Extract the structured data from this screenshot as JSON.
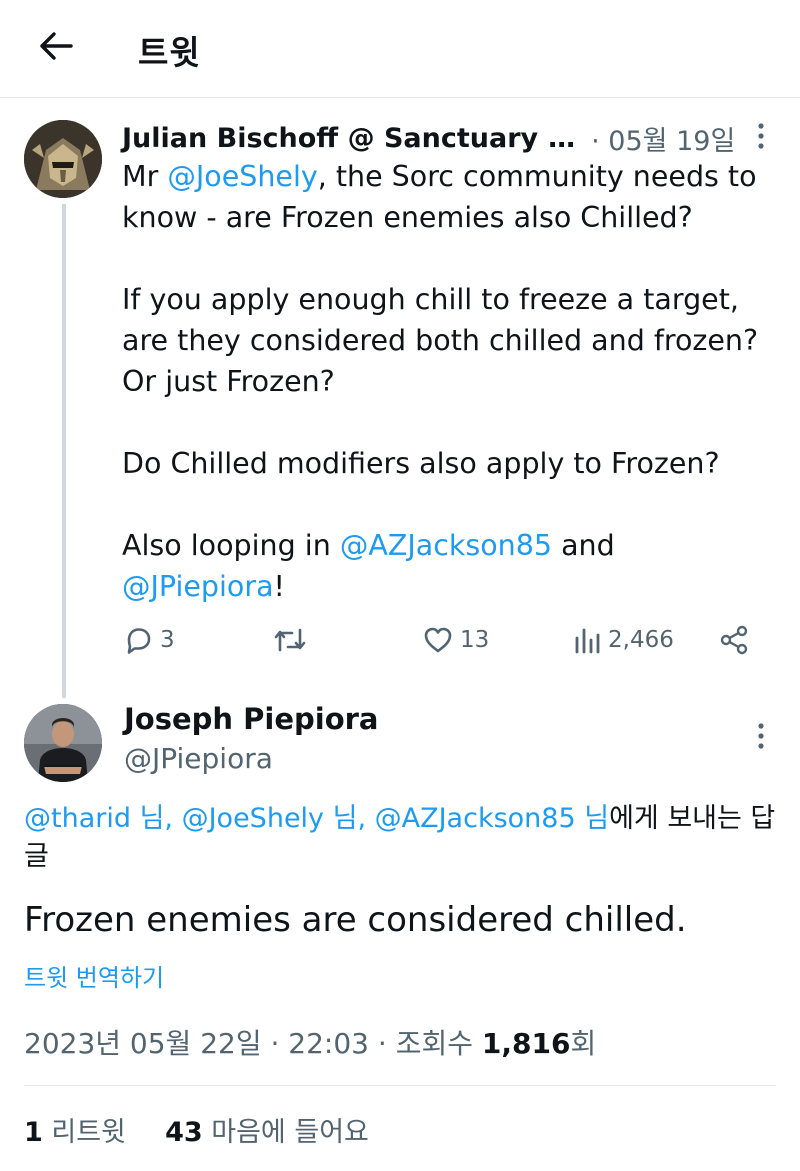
{
  "header": {
    "title": "트윗"
  },
  "thread_tweet": {
    "name": "Julian Bischoff @ Sanctuary",
    "ellipsis": "…",
    "time": "· 05월 19일",
    "text_parts": {
      "p1_pre": "Mr ",
      "p1_mention": "@JoeShely",
      "p1_post": ", the Sorc community needs to know - are Frozen enemies also Chilled?",
      "p2": "If you apply enough chill to freeze a target, are they considered both chilled and frozen? Or just Frozen?",
      "p3": "Do Chilled modifiers also apply to Frozen?",
      "p4_pre": "Also looping in ",
      "p4_mention1": "@AZJackson85",
      "p4_mid": " and ",
      "p4_mention2": "@JPiepiora",
      "p4_post": "!"
    },
    "actions": {
      "replies": "3",
      "retweets": "",
      "likes": "13",
      "views": "2,466"
    }
  },
  "main_tweet": {
    "name": "Joseph Piepiora",
    "handle": "@JPiepiora",
    "reply_to": {
      "m1": "@tharid 님",
      "sep1": ", ",
      "m2": "@JoeShely 님",
      "sep2": ", ",
      "m3": "@AZJackson85 님",
      "suffix": "에게 보내는 답글"
    },
    "text": "Frozen enemies are considered chilled.",
    "translate": "트윗 번역하기",
    "meta": {
      "datetime": "2023년 05월 22일 · 22:03 · 조회수 ",
      "views": "1,816",
      "views_suffix": "회"
    },
    "stats": {
      "retweets": "1",
      "retweets_label": " 리트윗",
      "likes": "43",
      "likes_label": " 마음에 들어요"
    }
  },
  "colors": {
    "accent": "#1d9bf0",
    "secondary_text": "#536471",
    "primary_text": "#0f1419",
    "divider": "#e6e9ec"
  },
  "icons": [
    "back-arrow-icon",
    "more-vertical-icon",
    "reply-icon",
    "retweet-icon",
    "heart-icon",
    "views-icon",
    "share-icon"
  ]
}
